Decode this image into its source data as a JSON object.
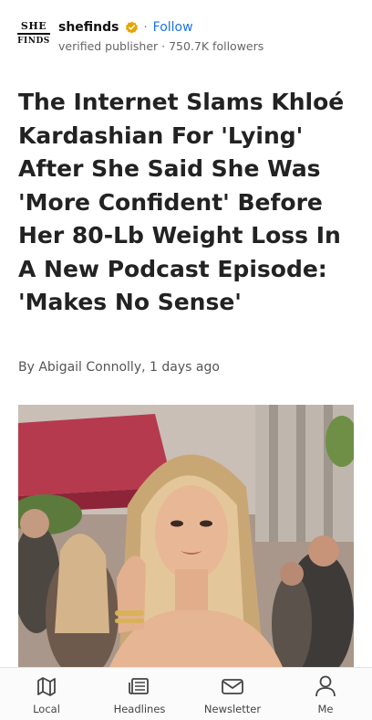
{
  "publisher": {
    "logo_text_top": "SHE",
    "logo_text_bottom": "FINDS",
    "name": "shefinds",
    "separator": "·",
    "follow_label": "Follow",
    "subtitle": "verified publisher · 750.7K followers",
    "verified_icon": "verified-badge-icon",
    "accent_color": "#1a73e8",
    "badge_color": "#e8a400"
  },
  "article": {
    "headline": "The Internet Slams Khloé Kardashian For 'Lying' After She Said She Was 'More Confident' Before Her 80-Lb Weight Loss In A New Podcast Episode: 'Makes No Sense'",
    "byline": "By Abigail Connolly, 1 days ago",
    "hero_image_icon": "article-photo"
  },
  "bottom_nav": {
    "items": [
      {
        "label": "Local",
        "icon": "map-icon"
      },
      {
        "label": "Headlines",
        "icon": "newspaper-icon"
      },
      {
        "label": "Newsletter",
        "icon": "envelope-icon"
      },
      {
        "label": "Me",
        "icon": "person-icon"
      }
    ]
  }
}
